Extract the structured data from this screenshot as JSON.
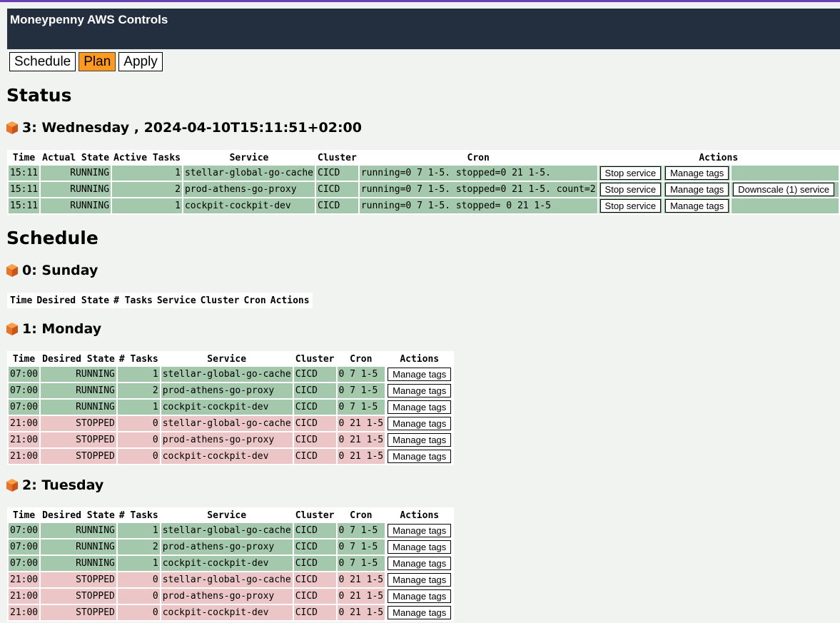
{
  "app": {
    "title": "Moneypenny AWS Controls"
  },
  "nav": {
    "items": [
      "Schedule",
      "Plan",
      "Apply"
    ],
    "active": "Plan"
  },
  "status": {
    "heading": "Status",
    "day_heading": "3: Wednesday , 2024-04-10T15:11:51+02:00",
    "columns": [
      "Time",
      "Actual State",
      "Active Tasks",
      "Service",
      "Cluster",
      "Cron",
      "Actions"
    ],
    "rows": [
      {
        "time": "15:11",
        "state": "RUNNING",
        "tasks": "1",
        "service": "stellar-global-go-cache",
        "cluster": "CICD",
        "cron": "running=0 7 1-5. stopped=0 21 1-5.",
        "actions": [
          "Stop service",
          "Manage tags"
        ]
      },
      {
        "time": "15:11",
        "state": "RUNNING",
        "tasks": "2",
        "service": "prod-athens-go-proxy",
        "cluster": "CICD",
        "cron": "running=0 7 1-5. stopped=0 21 1-5. count=2",
        "actions": [
          "Stop service",
          "Manage tags",
          "Downscale (1) service"
        ]
      },
      {
        "time": "15:11",
        "state": "RUNNING",
        "tasks": "1",
        "service": "cockpit-cockpit-dev",
        "cluster": "CICD",
        "cron": "running=0 7 1-5. stopped= 0 21 1-5",
        "actions": [
          "Stop service",
          "Manage tags"
        ]
      }
    ]
  },
  "schedule": {
    "heading": "Schedule",
    "columns": [
      "Time",
      "Desired State",
      "# Tasks",
      "Service",
      "Cluster",
      "Cron",
      "Actions"
    ],
    "days": [
      {
        "heading": "0: Sunday",
        "rows": []
      },
      {
        "heading": "1: Monday",
        "rows": [
          {
            "time": "07:00",
            "state": "RUNNING",
            "tasks": "1",
            "service": "stellar-global-go-cache",
            "cluster": "CICD",
            "cron": "0 7 1-5",
            "action": "Manage tags"
          },
          {
            "time": "07:00",
            "state": "RUNNING",
            "tasks": "2",
            "service": "prod-athens-go-proxy",
            "cluster": "CICD",
            "cron": "0 7 1-5",
            "action": "Manage tags"
          },
          {
            "time": "07:00",
            "state": "RUNNING",
            "tasks": "1",
            "service": "cockpit-cockpit-dev",
            "cluster": "CICD",
            "cron": "0 7 1-5",
            "action": "Manage tags"
          },
          {
            "time": "21:00",
            "state": "STOPPED",
            "tasks": "0",
            "service": "stellar-global-go-cache",
            "cluster": "CICD",
            "cron": "0 21 1-5",
            "action": "Manage tags"
          },
          {
            "time": "21:00",
            "state": "STOPPED",
            "tasks": "0",
            "service": "prod-athens-go-proxy",
            "cluster": "CICD",
            "cron": "0 21 1-5",
            "action": "Manage tags"
          },
          {
            "time": "21:00",
            "state": "STOPPED",
            "tasks": "0",
            "service": "cockpit-cockpit-dev",
            "cluster": "CICD",
            "cron": "0 21 1-5",
            "action": "Manage tags"
          }
        ]
      },
      {
        "heading": "2: Tuesday",
        "rows": [
          {
            "time": "07:00",
            "state": "RUNNING",
            "tasks": "1",
            "service": "stellar-global-go-cache",
            "cluster": "CICD",
            "cron": "0 7 1-5",
            "action": "Manage tags"
          },
          {
            "time": "07:00",
            "state": "RUNNING",
            "tasks": "2",
            "service": "prod-athens-go-proxy",
            "cluster": "CICD",
            "cron": "0 7 1-5",
            "action": "Manage tags"
          },
          {
            "time": "07:00",
            "state": "RUNNING",
            "tasks": "1",
            "service": "cockpit-cockpit-dev",
            "cluster": "CICD",
            "cron": "0 7 1-5",
            "action": "Manage tags"
          },
          {
            "time": "21:00",
            "state": "STOPPED",
            "tasks": "0",
            "service": "stellar-global-go-cache",
            "cluster": "CICD",
            "cron": "0 21 1-5",
            "action": "Manage tags"
          },
          {
            "time": "21:00",
            "state": "STOPPED",
            "tasks": "0",
            "service": "prod-athens-go-proxy",
            "cluster": "CICD",
            "cron": "0 21 1-5",
            "action": "Manage tags"
          },
          {
            "time": "21:00",
            "state": "STOPPED",
            "tasks": "0",
            "service": "cockpit-cockpit-dev",
            "cluster": "CICD",
            "cron": "0 21 1-5",
            "action": "Manage tags"
          }
        ]
      }
    ]
  },
  "colors": {
    "header_bg": "#232f3e",
    "active_nav": "#ff9a1f",
    "running_row": "#a4c8ab",
    "stopped_row": "#ecc6c6"
  },
  "icons": {
    "day_marker": "cube-icon"
  }
}
